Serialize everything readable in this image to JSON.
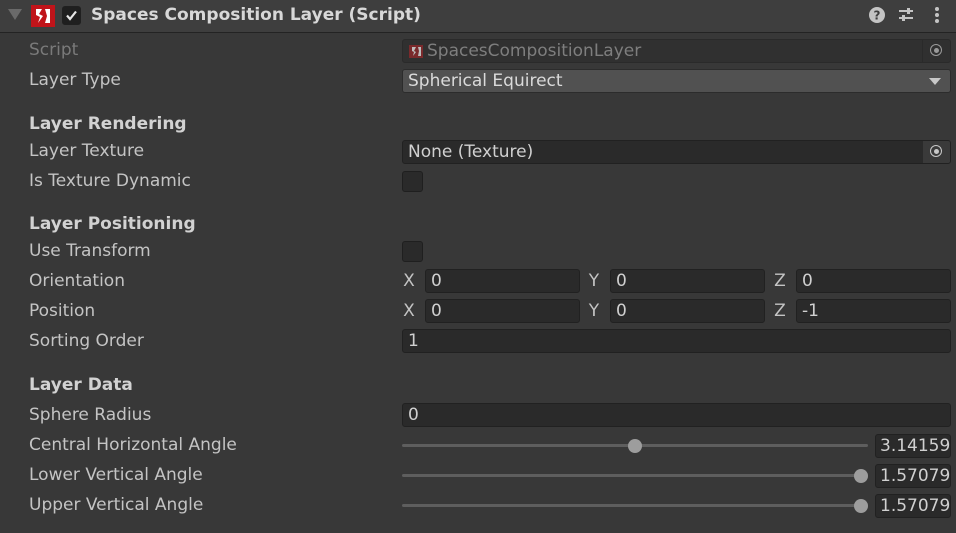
{
  "header": {
    "title": "Spaces Composition Layer (Script)",
    "enabled": true,
    "icons": [
      "foldout-arrow-icon",
      "component-logo-icon",
      "help-icon",
      "presets-icon",
      "more-menu-icon"
    ]
  },
  "script_field": {
    "label": "Script",
    "value": "SpacesCompositionLayer"
  },
  "layer_type": {
    "label": "Layer Type",
    "value": "Spherical Equirect"
  },
  "sections": {
    "rendering": "Layer Rendering",
    "positioning": "Layer Positioning",
    "data": "Layer Data"
  },
  "layer_texture": {
    "label": "Layer Texture",
    "value": "None (Texture)"
  },
  "is_texture_dynamic": {
    "label": "Is Texture Dynamic",
    "checked": false
  },
  "use_transform": {
    "label": "Use Transform",
    "checked": false
  },
  "orientation": {
    "label": "Orientation",
    "x_label": "X",
    "y_label": "Y",
    "z_label": "Z",
    "x": "0",
    "y": "0",
    "z": "0"
  },
  "position": {
    "label": "Position",
    "x_label": "X",
    "y_label": "Y",
    "z_label": "Z",
    "x": "0",
    "y": "0",
    "z": "-1"
  },
  "sorting_order": {
    "label": "Sorting Order",
    "value": "1"
  },
  "sphere_radius": {
    "label": "Sphere Radius",
    "value": "0"
  },
  "central_horizontal_angle": {
    "label": "Central Horizontal Angle",
    "value": "3.14159",
    "fraction": 0.5
  },
  "lower_vertical_angle": {
    "label": "Lower Vertical Angle",
    "value": "1.57079",
    "fraction": 1.0
  },
  "upper_vertical_angle": {
    "label": "Upper Vertical Angle",
    "value": "1.57079",
    "fraction": 1.0
  },
  "colors": {
    "background": "#383838",
    "header": "#3e3e3e",
    "field": "#2a2a2a",
    "dropdown": "#515151",
    "logo_red": "#c0141a"
  }
}
